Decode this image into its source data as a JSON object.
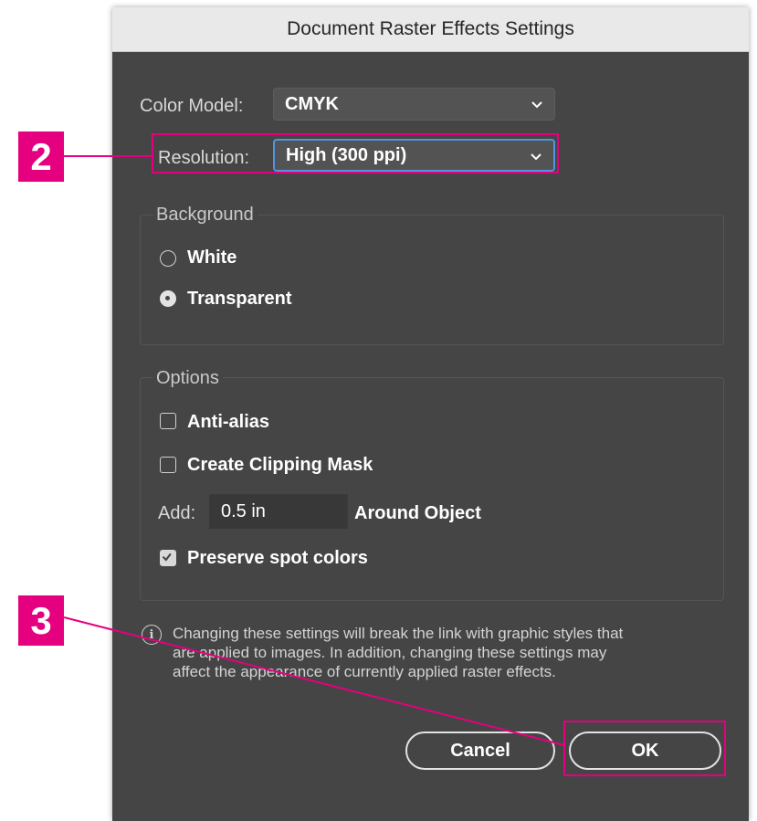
{
  "dialog": {
    "title": "Document Raster Effects Settings",
    "color_model": {
      "label": "Color Model:",
      "value": "CMYK"
    },
    "resolution": {
      "label": "Resolution:",
      "value": "High (300 ppi)"
    },
    "background": {
      "title": "Background",
      "options": [
        {
          "label": "White",
          "selected": false
        },
        {
          "label": "Transparent",
          "selected": true
        }
      ]
    },
    "options": {
      "title": "Options",
      "anti_alias": {
        "label": "Anti-alias",
        "checked": false
      },
      "clipping_mask": {
        "label": "Create Clipping Mask",
        "checked": false
      },
      "add_label": "Add:",
      "add_value": "0.5 in",
      "around_label": "Around Object",
      "preserve_spot": {
        "label": "Preserve spot colors",
        "checked": true
      }
    },
    "info_lines": [
      "Changing these settings will break the link with graphic styles that",
      "are applied to images. In addition, changing these settings may",
      "affect the appearance of currently applied raster effects."
    ],
    "cancel_label": "Cancel",
    "ok_label": "OK"
  },
  "annotations": {
    "step2": "2",
    "step3": "3",
    "color": "#e5007f"
  },
  "icons": {
    "select_arrow": "chevron-down-icon",
    "info": "info-icon",
    "check": "checkmark-icon"
  }
}
